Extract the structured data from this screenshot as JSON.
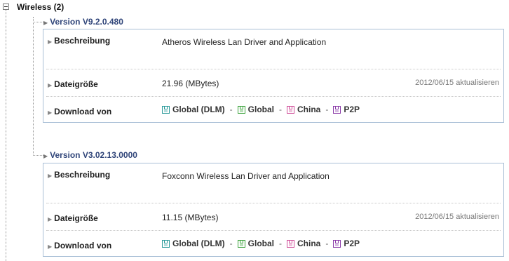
{
  "section": {
    "title": "Wireless (2)"
  },
  "versions": [
    {
      "title": "Version V9.2.0.480",
      "desc_label": "Beschreibung",
      "desc": "Atheros Wireless Lan Driver and Application",
      "size_label": "Dateigröße",
      "size": "21.96 (MBytes)",
      "updated": "2012/06/15 aktualisieren",
      "download_label": "Download von",
      "links": [
        "Global (DLM)",
        "Global",
        "China",
        "P2P"
      ],
      "sep": "-"
    },
    {
      "title": "Version V3.02.13.0000",
      "desc_label": "Beschreibung",
      "desc": "Foxconn Wireless Lan Driver and Application",
      "size_label": "Dateigröße",
      "size": "11.15 (MBytes)",
      "updated": "2012/06/15 aktualisieren",
      "download_label": "Download von",
      "links": [
        "Global (DLM)",
        "Global",
        "China",
        "P2P"
      ],
      "sep": "-"
    }
  ],
  "icons": {
    "collapse": "minus-box-icon",
    "row_marker": "triangle-right-icon",
    "download": "floppy-disk-icon"
  },
  "colors": {
    "version_title": "#31467a",
    "box_border": "#a9bfd6",
    "dlm_icon": "#2a9a9a",
    "global_icon": "#3aa23a",
    "china_icon": "#d0509a",
    "p2p_icon": "#8a3aa8"
  }
}
